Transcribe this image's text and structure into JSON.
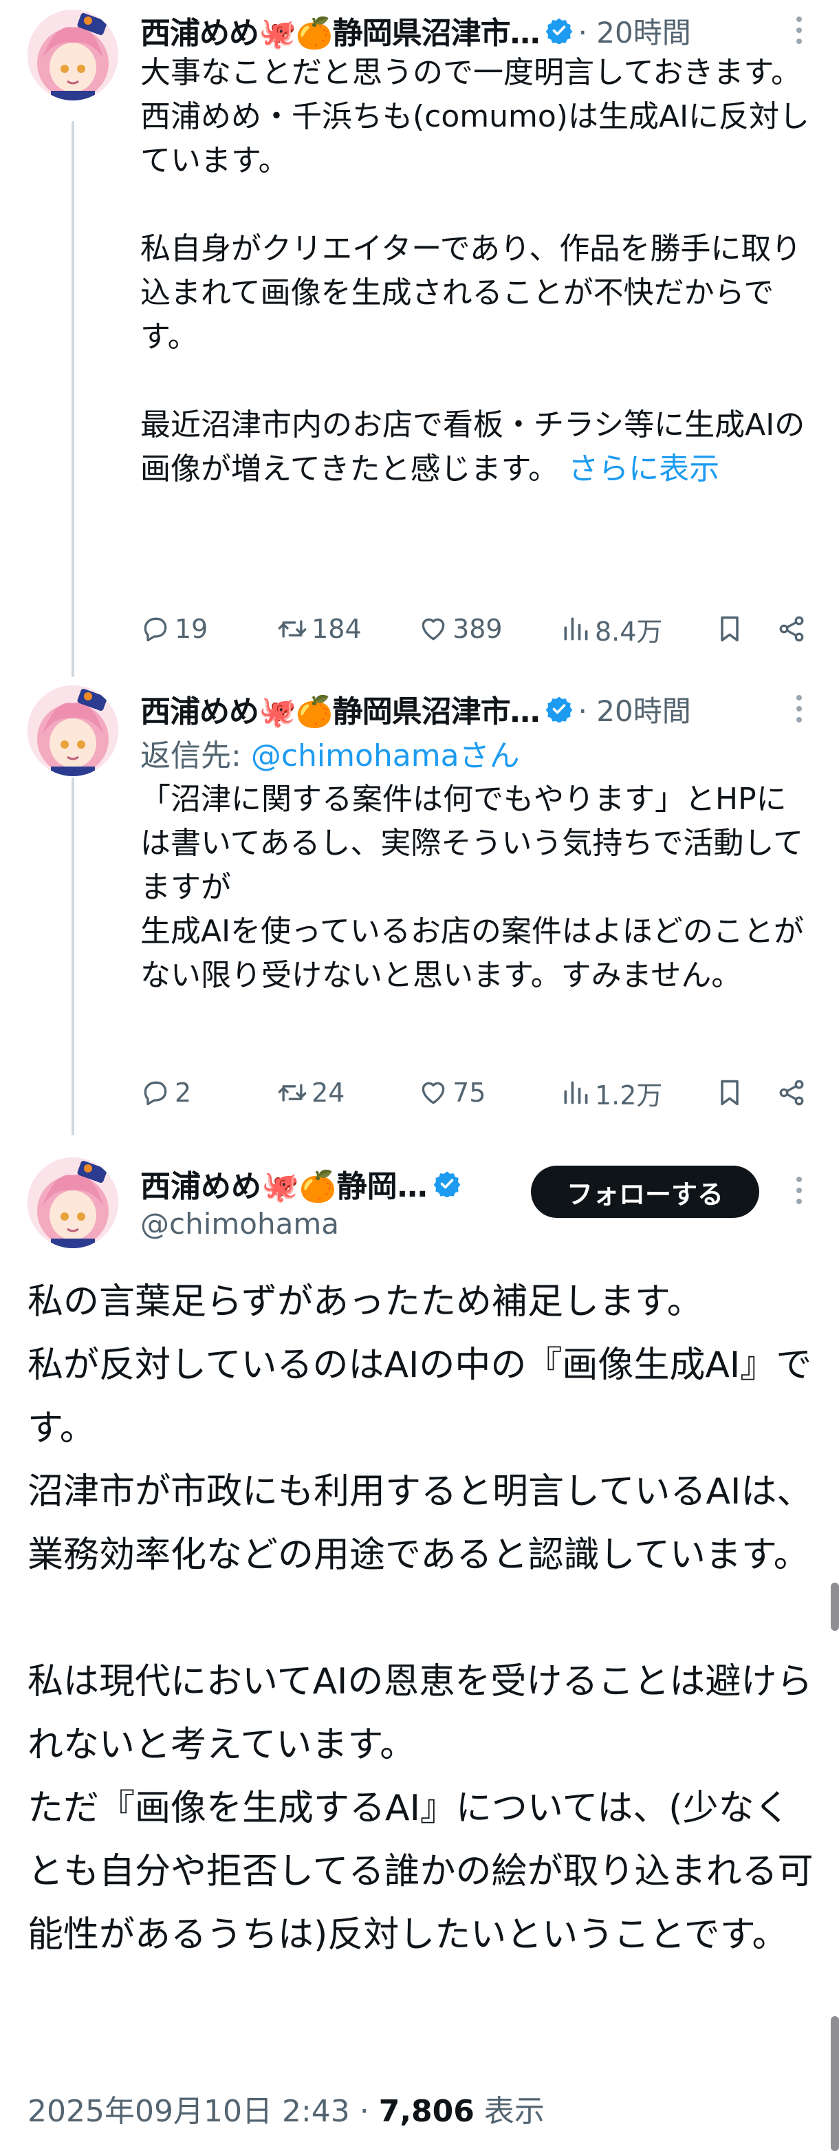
{
  "tweets": [
    {
      "name": "西浦めめ🐙🍊静岡県沼津市…",
      "time": "· 20時間",
      "text": "大事なことだと思うので一度明言しておきます。\n西浦めめ・千浜ちも(comumo)は生成AIに反対しています。\n\n私自身がクリエイターであり、作品を勝手に取り込まれて画像を生成されることが不快だからです。\n\n最近沼津市内のお店で看板・チラシ等に生成AIの画像が増えてきたと感じます。",
      "show_more": "さらに表示",
      "replies": "19",
      "retweets": "184",
      "likes": "389",
      "views": "8.4万"
    },
    {
      "name": "西浦めめ🐙🍊静岡県沼津市…",
      "time": "· 20時間",
      "reply_to_label": "返信先: ",
      "reply_to_handle": "@chimohamaさん",
      "text": "「沼津に関する案件は何でもやります」とHPには書いてあるし、実際そういう気持ちで活動してますが\n生成AIを使っているお店の案件はよほどのことがない限り受けないと思います。すみません。",
      "replies": "2",
      "retweets": "24",
      "likes": "75",
      "views": "1.2万"
    }
  ],
  "main": {
    "name": "西浦めめ🐙🍊静岡…",
    "handle": "@chimohama",
    "follow_label": "フォローする",
    "text": "私の言葉足らずがあったため補足します。\n私が反対しているのはAIの中の『画像生成AI』です。\n沼津市が市政にも利用すると明言しているAIは、業務効率化などの用途であると認識しています。\n\n私は現代においてAIの恩恵を受けることは避けられないと考えています。\nただ『画像を生成するAI』については、(少なくとも自分や拒否してる誰かの絵が取り込まれる可能性があるうちは)反対したいということです。",
    "date": "2025年09月10日 2:43 · ",
    "views_count": "7,806",
    "views_label": " 表示"
  },
  "colors": {
    "accent": "#1d9bf0",
    "follow_bg": "#0f1419",
    "muted": "#536471"
  },
  "icons": [
    "verified-badge-icon",
    "more-icon",
    "reply-icon",
    "retweet-icon",
    "like-icon",
    "views-icon",
    "bookmark-icon",
    "share-icon"
  ]
}
